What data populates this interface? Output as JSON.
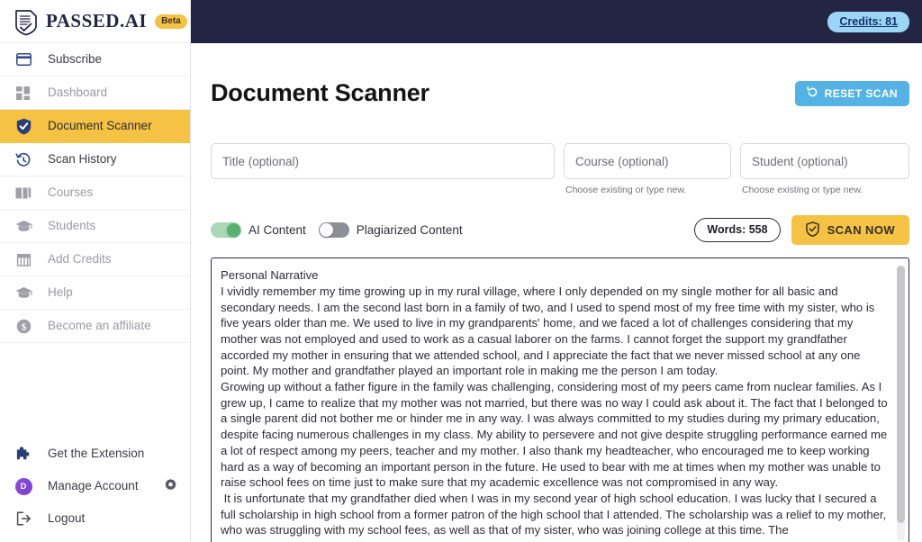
{
  "brand": {
    "name": "PASSED.AI",
    "badge": "Beta",
    "logo_icon": "shield-document-check-icon"
  },
  "topbar": {
    "credits_label": "Credits: 81"
  },
  "sidebar": {
    "items": [
      {
        "label": "Subscribe",
        "icon": "credit-card-icon",
        "state": "normal"
      },
      {
        "label": "Dashboard",
        "icon": "grid-icon",
        "state": "dim"
      },
      {
        "label": "Document Scanner",
        "icon": "shield-check-icon",
        "state": "active"
      },
      {
        "label": "Scan History",
        "icon": "history-clock-icon",
        "state": "normal"
      },
      {
        "label": "Courses",
        "icon": "book-icon",
        "state": "dim"
      },
      {
        "label": "Students",
        "icon": "graduation-cap-icon",
        "state": "dim"
      },
      {
        "label": "Add Credits",
        "icon": "store-icon",
        "state": "dim"
      },
      {
        "label": "Help",
        "icon": "graduation-cap-icon",
        "state": "dim"
      },
      {
        "label": "Become an affiliate",
        "icon": "dollar-circle-icon",
        "state": "dim"
      }
    ],
    "bottom_items": [
      {
        "label": "Get the Extension",
        "icon": "puzzle-piece-icon"
      },
      {
        "label": "Manage Account",
        "icon": "avatar-icon",
        "avatar_letter": "D",
        "trailing_icon": "gear-icon"
      },
      {
        "label": "Logout",
        "icon": "logout-icon"
      }
    ]
  },
  "main": {
    "page_title": "Document Scanner",
    "reset_button": {
      "label": "RESET SCAN",
      "icon": "refresh-icon"
    },
    "fields": {
      "title": {
        "placeholder": "Title (optional)",
        "value": "",
        "hint": ""
      },
      "course": {
        "placeholder": "Course (optional)",
        "value": "",
        "hint": "Choose existing or type new."
      },
      "student": {
        "placeholder": "Student (optional)",
        "value": "",
        "hint": "Choose existing or type new."
      }
    },
    "toggles": [
      {
        "label": "AI Content",
        "on": true
      },
      {
        "label": "Plagiarized Content",
        "on": false
      }
    ],
    "words_pill": "Words: 558",
    "scan_button": {
      "label": "SCAN NOW",
      "icon": "shield-check-icon"
    },
    "document": {
      "heading": "Personal Narrative",
      "body": "I vividly remember my time growing up in my rural village, where I only depended on my single mother for all basic and secondary needs. I am the second last born in a family of two, and I used to spend most of my free time with my sister, who is five years older than me. We used to live in my grandparents' home, and we faced a lot of challenges considering that my mother was not employed and used to work as a casual laborer on the farms. I cannot forget the support my grandfather accorded my mother in ensuring that we attended school, and I appreciate the fact that we never missed school at any one point. My mother and grandfather played an important role in making me the person I am today.\nGrowing up without a father figure in the family was challenging, considering most of my peers came from nuclear families. As I grew up, I came to realize that my mother was not married, but there was no way I could ask about it. The fact that I belonged to a single parent did not bother me or hinder me in any way. I was always committed to my studies during my primary education, despite facing numerous challenges in my class. My ability to persevere and not give despite struggling performance earned me a lot of respect among my peers, teacher and my mother. I also thank my headteacher, who encouraged me to keep working hard as a way of becoming an important person in the future. He used to bear with me at times when my mother was unable to raise school fees on time just to make sure that my academic excellence was not compromised in any way.\n It is unfortunate that my grandfather died when I was in my second year of high school education. I was lucky that I secured a full scholarship in high school from a former patron of the high school that I attended. The scholarship was a relief to my mother, who was struggling with my school fees, as well as that of my sister, who was joining college at this time. The"
    }
  },
  "colors": {
    "navy": "#232544",
    "yellow": "#F5C243",
    "blue": "#54B3E4",
    "credits_pill": "#9BD7F5",
    "toggle_on": "#56b271"
  }
}
